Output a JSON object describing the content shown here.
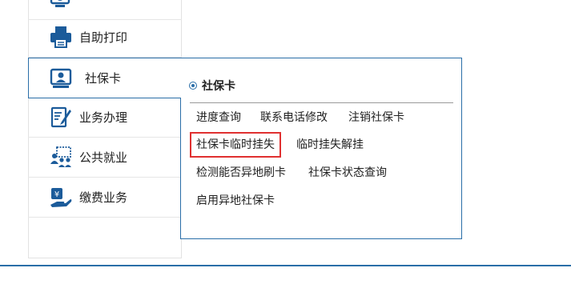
{
  "nav": {
    "items": [
      {
        "label": "自助打印"
      },
      {
        "label": "社保卡"
      },
      {
        "label": "业务办理"
      },
      {
        "label": "公共就业"
      },
      {
        "label": "缴费业务"
      }
    ]
  },
  "popup": {
    "title": "社保卡",
    "links": [
      "进度查询",
      "联系电话修改",
      "注销社保卡",
      "社保卡临时挂失",
      "临时挂失解挂",
      "检测能否异地刷卡",
      "社保卡状态查询",
      "启用异地社保卡"
    ]
  },
  "colors": {
    "accent": "#2a6ea8",
    "highlight_border": "#e03030"
  }
}
